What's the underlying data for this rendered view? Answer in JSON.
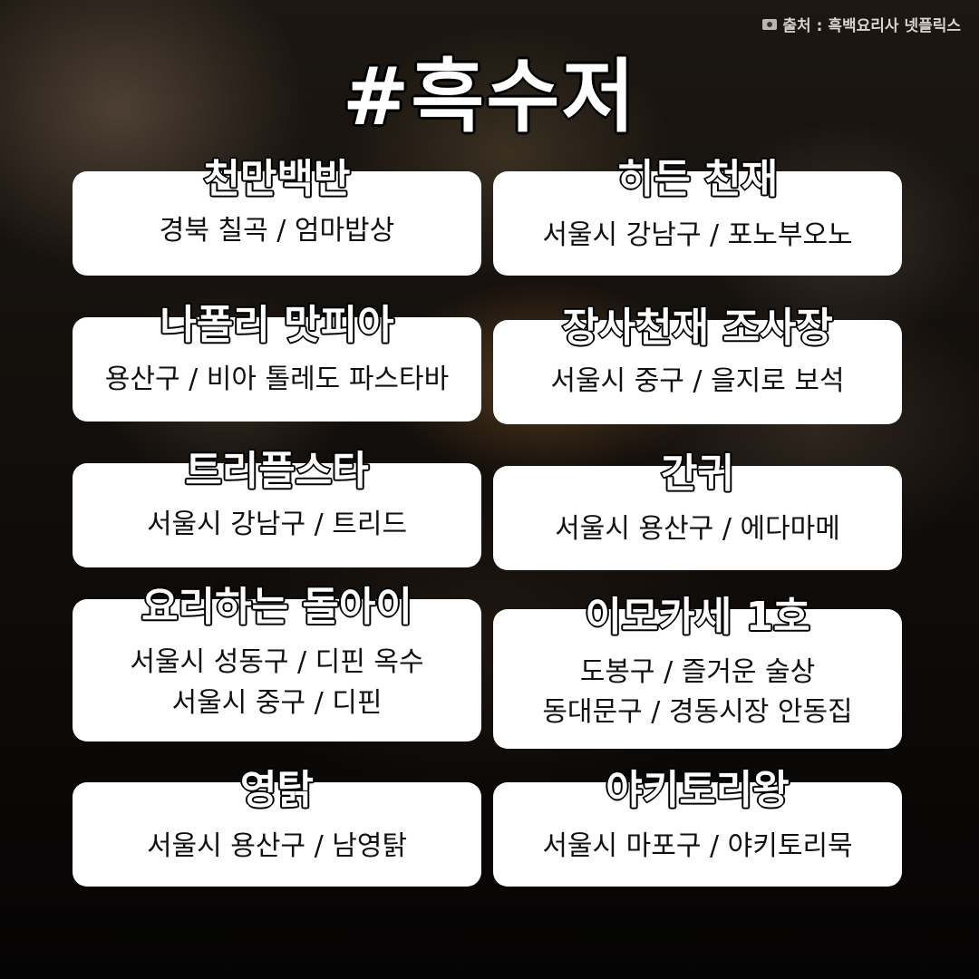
{
  "credit": "출처 : 흑백요리사 넷플릭스",
  "credit_icon": "camera-icon",
  "title": "#흑수저",
  "cards": [
    {
      "name": "천만백반",
      "lines": [
        "경북 칠곡 / 엄마밥상"
      ]
    },
    {
      "name": "히든 천재",
      "lines": [
        "서울시 강남구 / 포노부오노"
      ]
    },
    {
      "name": "나폴리 맛피아",
      "lines": [
        "용산구 / 비아 톨레도 파스타바"
      ]
    },
    {
      "name": "장사천재 조사장",
      "lines": [
        "서울시 중구 / 을지로 보석"
      ]
    },
    {
      "name": "트리플스타",
      "lines": [
        "서울시 강남구 / 트리드"
      ]
    },
    {
      "name": "간귀",
      "lines": [
        "서울시 용산구 / 에다마메"
      ]
    },
    {
      "name": "요리하는 돌아이",
      "lines": [
        "서울시 성동구 / 디핀 옥수",
        "서울시 중구 / 디핀"
      ]
    },
    {
      "name": "이모카세 1호",
      "lines": [
        "도봉구 / 즐거운 술상",
        "동대문구 / 경동시장 안동집"
      ]
    },
    {
      "name": "영탉",
      "lines": [
        "서울시 용산구 / 남영탉"
      ]
    },
    {
      "name": "야키토리왕",
      "lines": [
        "서울시 마포구 / 야키토리묵"
      ]
    }
  ]
}
